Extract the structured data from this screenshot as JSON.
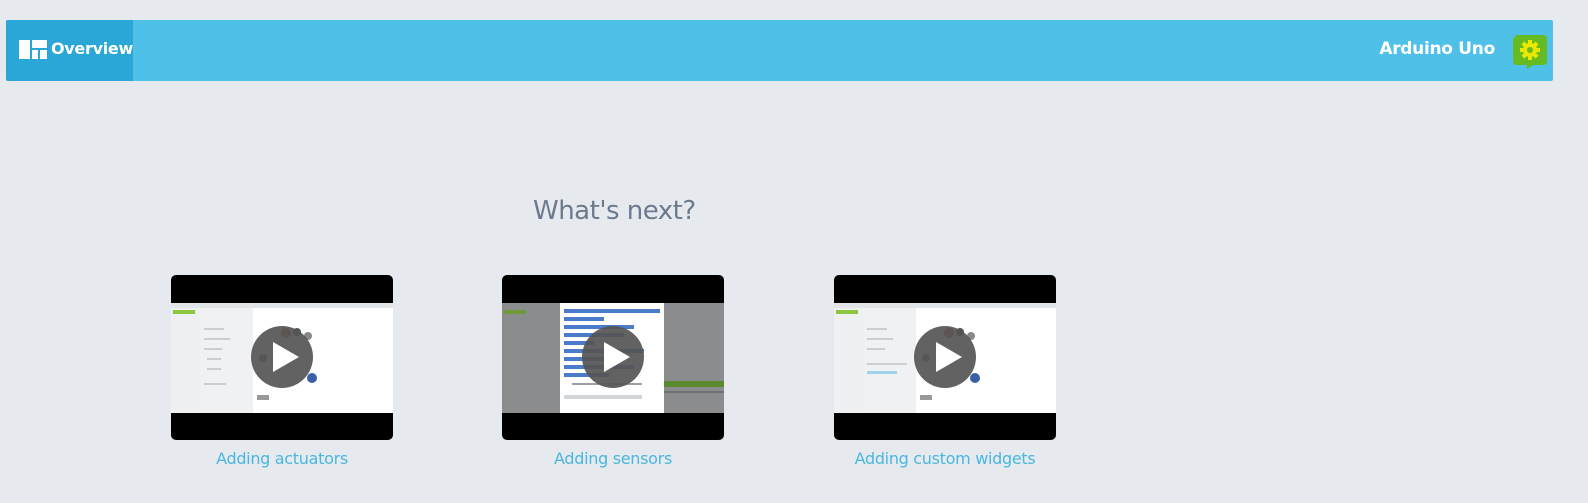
{
  "header": {
    "overview_label": "Overview",
    "overview_icon": "dashboard-layout-icon",
    "device_name": "Arduino Uno",
    "device_icon": "gear-icon"
  },
  "main": {
    "title": "What's next?",
    "videos": [
      {
        "label": "Adding actuators",
        "icon": "play-icon"
      },
      {
        "label": "Adding sensors",
        "icon": "play-icon"
      },
      {
        "label": "Adding custom widgets",
        "icon": "play-icon"
      }
    ]
  },
  "colors": {
    "topbar": "#4fc1e8",
    "topbar_active": "#2aa7d7",
    "background": "#e6eaef",
    "link": "#4ab7df",
    "title": "#6b7a8c",
    "gear_green": "#66bb22",
    "gear_yellow": "#e8e800"
  }
}
